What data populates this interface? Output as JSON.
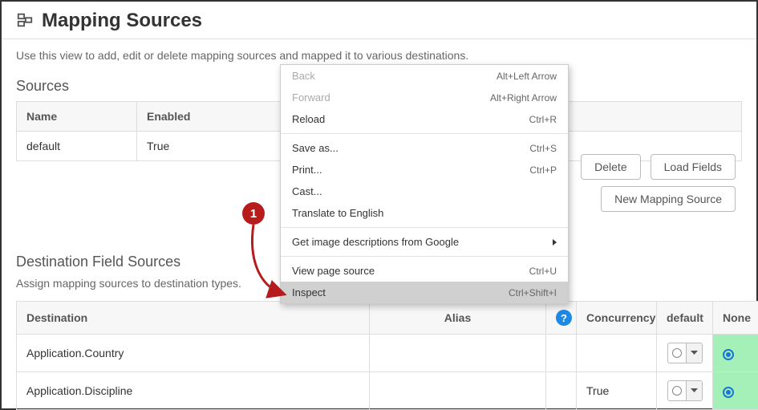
{
  "header": {
    "title": "Mapping Sources"
  },
  "description": "Use this view to add, edit or delete mapping sources and mapped it to various destinations.",
  "sources": {
    "title": "Sources",
    "columns": {
      "name": "Name",
      "enabled": "Enabled"
    },
    "rows": [
      {
        "name": "default",
        "enabled": "True"
      }
    ],
    "buttons": {
      "delete": "Delete",
      "load_fields": "Load Fields",
      "new_source": "New Mapping Source"
    }
  },
  "destinations": {
    "title": "Destination Field Sources",
    "desc": "Assign mapping sources to destination types.",
    "columns": {
      "destination": "Destination",
      "alias": "Alias",
      "concurrency": "Concurrency",
      "default": "default",
      "none": "None"
    },
    "rows": [
      {
        "destination": "Application.Country",
        "alias": "",
        "concurrency": "",
        "none_selected": true
      },
      {
        "destination": "Application.Discipline",
        "alias": "",
        "concurrency": "True",
        "none_selected": true
      }
    ]
  },
  "context_menu": {
    "items": [
      {
        "label": "Back",
        "shortcut": "Alt+Left Arrow",
        "disabled": true
      },
      {
        "label": "Forward",
        "shortcut": "Alt+Right Arrow",
        "disabled": true
      },
      {
        "label": "Reload",
        "shortcut": "Ctrl+R"
      },
      {
        "sep": true
      },
      {
        "label": "Save as...",
        "shortcut": "Ctrl+S"
      },
      {
        "label": "Print...",
        "shortcut": "Ctrl+P"
      },
      {
        "label": "Cast..."
      },
      {
        "label": "Translate to English"
      },
      {
        "sep": true
      },
      {
        "label": "Get image descriptions from Google",
        "submenu": true
      },
      {
        "sep": true
      },
      {
        "label": "View page source",
        "shortcut": "Ctrl+U"
      },
      {
        "label": "Inspect",
        "shortcut": "Ctrl+Shift+I",
        "highlight": true
      }
    ]
  },
  "annotation": {
    "badge": "1"
  }
}
